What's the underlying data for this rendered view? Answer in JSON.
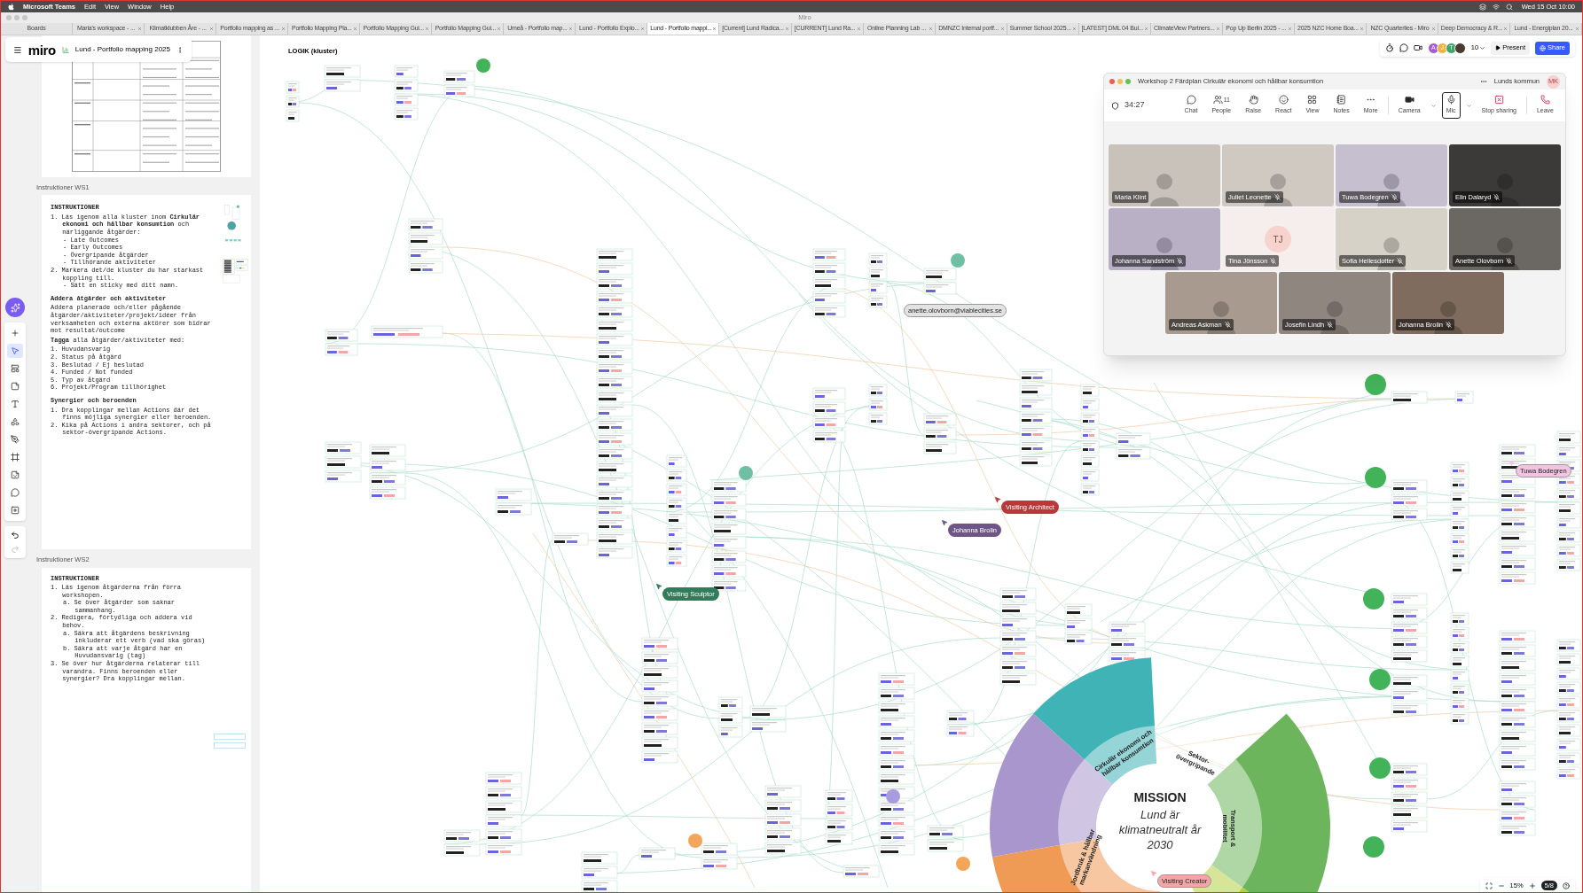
{
  "menu_bar": {
    "app": "Microsoft Teams",
    "menus": [
      "Edit",
      "View",
      "Window",
      "Help"
    ],
    "clock": "Wed 15 Oct 10:00"
  },
  "browser": {
    "title": "Miro",
    "tabs": [
      {
        "label": "Boards",
        "selected": false
      },
      {
        "label": "Maria's workspace - ...",
        "selected": false
      },
      {
        "label": "Klimatklubben Åre - ...",
        "selected": false
      },
      {
        "label": "Portfolio mapping as ...",
        "selected": false
      },
      {
        "label": "Portfolio Mapping Pla...",
        "selected": false
      },
      {
        "label": "Portfolio Mapping Gui...",
        "selected": false
      },
      {
        "label": "Portfolio Mapping Gui...",
        "selected": false
      },
      {
        "label": "Umeå - Portfolio map...",
        "selected": false
      },
      {
        "label": "Lund - Portfolio Explo...",
        "selected": false
      },
      {
        "label": "Lund - Portfolio mappi...",
        "selected": true
      },
      {
        "label": "[Current] Lund Radica...",
        "selected": false
      },
      {
        "label": "[CURRENT] Lund Ra...",
        "selected": false
      },
      {
        "label": "Online Planning Lab ...",
        "selected": false
      },
      {
        "label": "DMNZC Internal portf...",
        "selected": false
      },
      {
        "label": "Summer School 2025...",
        "selected": false
      },
      {
        "label": "[LATEST] DML 04 Bui...",
        "selected": false
      },
      {
        "label": "ClimateView Partners...",
        "selected": false
      },
      {
        "label": "Pop Up Berlin 2025 - ...",
        "selected": false
      },
      {
        "label": "2025 NZC Home Boa...",
        "selected": false
      },
      {
        "label": "NZC Quarterlies - Miro",
        "selected": false
      },
      {
        "label": "Deep Democracy & R...",
        "selected": false
      },
      {
        "label": "Lund - Energiplan 20...",
        "selected": false
      }
    ]
  },
  "board": {
    "logo": "miro",
    "name": "Lund - Portfolio mapping 2025"
  },
  "top_right": {
    "avatars": [
      "A",
      "J",
      "T"
    ],
    "participant_count": "10",
    "present": "Present",
    "share": "Share"
  },
  "left_toolbar": {
    "tools": [
      {
        "selected": false
      },
      {
        "selected": true
      },
      {
        "selected": false
      },
      {
        "selected": false
      },
      {
        "selected": false
      },
      {
        "selected": false
      },
      {
        "selected": false
      },
      {
        "selected": false
      },
      {
        "selected": false
      },
      {
        "selected": false
      },
      {
        "selected": false
      }
    ]
  },
  "frames": [
    {
      "title": "Instruktioner WS1",
      "blocks": [
        {
          "kind": "heading",
          "text": "INSTRUKTIONER"
        },
        {
          "kind": "list",
          "items": [
            {
              "marker": "1.",
              "text": "Läs igenom alla kluster inom **Cirkulär ekonomi och hållbar konsumtion** och närliggande åtgärder:",
              "children": [
                {
                  "marker": "-",
                  "text": "Late Outcomes"
                },
                {
                  "marker": "-",
                  "text": "Early Outcomes"
                },
                {
                  "marker": "-",
                  "text": "Övergripande åtgärder"
                },
                {
                  "marker": "-",
                  "text": "Tillhörande aktiviteter"
                }
              ]
            },
            {
              "marker": "2.",
              "text": "Markera det/de kluster du har starkast koppling till.",
              "children": [
                {
                  "marker": "-",
                  "text": "Sätt en sticky med ditt namn."
                }
              ]
            }
          ]
        },
        {
          "kind": "heading",
          "text": "Addera åtgärder och aktiviteter"
        },
        {
          "kind": "paragraph",
          "text": "Addera planerade och/eller pågående åtgärder/aktiviteter/projekt/idéer från verksamheten och externa aktörer som bidrar mot resultat/outcome"
        },
        {
          "kind": "paragraph",
          "text": "**Tagga** alla åtgärder/aktiviteter med:"
        },
        {
          "kind": "list",
          "items": [
            {
              "marker": "1.",
              "text": "Huvudansvarig"
            },
            {
              "marker": "2.",
              "text": "Status på åtgärd"
            },
            {
              "marker": "3.",
              "text": "Beslutad / Ej beslutad"
            },
            {
              "marker": "4.",
              "text": "Funded / Not funded"
            },
            {
              "marker": "5.",
              "text": "Typ av åtgärd"
            },
            {
              "marker": "6.",
              "text": "Projekt/Program tillhörighet"
            }
          ]
        },
        {
          "kind": "heading",
          "text": "Synergier och beroenden"
        },
        {
          "kind": "list",
          "items": [
            {
              "marker": "1.",
              "text": "Dra kopplingar mellan Actions där det finns möjliga synergier eller beroenden."
            },
            {
              "marker": "2.",
              "text": "Kika på Actions i andra sektorer, och på sektor-övergripande Actions."
            }
          ]
        }
      ]
    },
    {
      "title": "Instruktioner WS2",
      "blocks": [
        {
          "kind": "heading",
          "text": "INSTRUKTIONER"
        },
        {
          "kind": "list",
          "items": [
            {
              "marker": "1.",
              "text": "Läs igenom åtgärderna från förra workshopen.",
              "children": [
                {
                  "marker": "a.",
                  "text": "Se över åtgärder som saknar sammanhang."
                }
              ]
            },
            {
              "marker": "2.",
              "text": "Redigera, förtydliga och addera vid behov.",
              "children": [
                {
                  "marker": "a.",
                  "text": "Säkra att åtgärdens beskrivning inkluderar ett verb (vad ska göras)"
                },
                {
                  "marker": "b.",
                  "text": "Säkra att varje åtgärd har en Huvudansvarig (tag)"
                }
              ]
            },
            {
              "marker": "3.",
              "text": "Se över hur åtgärderna relaterar till varandra. Finns beroenden eller synergier? Dra kopplingar mellan."
            }
          ]
        }
      ]
    }
  ],
  "canvas": {
    "section_title": "LOGIK (kluster)",
    "cursors": [
      {
        "name": "anette.olovborn@viablecities.se",
        "color": "#e3e3e3"
      },
      {
        "name": "Visiting Architect",
        "color": "#b8383b"
      },
      {
        "name": "Johanna Brolin",
        "color": "#6e5585"
      },
      {
        "name": "Visiting Sculptor",
        "color": "#2f7d5a"
      },
      {
        "name": "Tuwa Bodegren",
        "color": "#f3c4e2"
      },
      {
        "name": "Visiting Creator",
        "color": "#f4a5a8"
      }
    ]
  },
  "mission": {
    "title": "MISSION",
    "subtitle": "Lund är klimatneutralt år 2030",
    "segments": [
      {
        "label": "Cirkulär ekonomi och hållbar konsumtion",
        "color": "#3fb3b6"
      },
      {
        "label": "Sektor-övergripande"
      },
      {
        "label": "Transport & mobilitet",
        "color": "#6db55c"
      },
      {
        "label": "Jordbruk & hållbar markanvändning",
        "color": "#ef9a55"
      }
    ]
  },
  "zoom_controls": {
    "zoom": "15%",
    "pages": "5/8"
  },
  "meeting": {
    "title": "Workshop 2 Färdplan Cirkulär ekonomi och hållbar konsumtion",
    "org": "Lunds kommun",
    "avatar": "MK",
    "timer": "34:27",
    "controls": [
      {
        "label": "Chat",
        "selected": false
      },
      {
        "label": "People",
        "badge": "11",
        "selected": false
      },
      {
        "label": "Raise",
        "selected": false
      },
      {
        "label": "React",
        "selected": false
      },
      {
        "label": "View",
        "selected": false
      },
      {
        "label": "Notes",
        "selected": false
      },
      {
        "label": "More",
        "selected": false
      },
      {
        "label": "Camera",
        "selected": false
      },
      {
        "label": "Mic",
        "selected": true
      },
      {
        "label": "Stop sharing",
        "selected": false
      },
      {
        "label": "Leave",
        "selected": false
      }
    ],
    "participants": [
      {
        "name": "Maria Klint",
        "kind": "video",
        "muted": false
      },
      {
        "name": "Juliet Leonette",
        "kind": "video",
        "muted": true
      },
      {
        "name": "Tuwa Bodegren",
        "kind": "video",
        "muted": true
      },
      {
        "name": "Elin Dalaryd",
        "kind": "video",
        "muted": true
      },
      {
        "name": "Johanna Sandström",
        "kind": "video",
        "muted": true
      },
      {
        "name": "Tina Jönsson",
        "kind": "initials",
        "initials": "TJ",
        "muted": true
      },
      {
        "name": "Sofia Hellesdotter",
        "kind": "video",
        "muted": true
      },
      {
        "name": "Anette Olovborn",
        "kind": "video",
        "muted": true
      },
      {
        "name": "Andreas Askman",
        "kind": "video",
        "muted": true
      },
      {
        "name": "Josefin Lindh",
        "kind": "video",
        "muted": true
      },
      {
        "name": "Johanna Brolin",
        "kind": "video",
        "muted": true
      }
    ]
  }
}
